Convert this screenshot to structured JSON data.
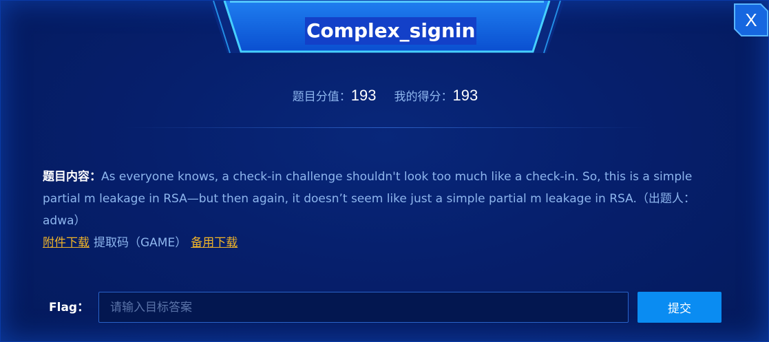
{
  "dialog": {
    "title": "Complex_signin",
    "close_label": "X"
  },
  "score": {
    "points_label": "题目分值：",
    "points_value": "193",
    "my_score_label": "我的得分：",
    "my_score_value": "193"
  },
  "content": {
    "label": "题目内容：",
    "text": "As everyone knows, a check-in challenge shouldn't look too much like a check-in. So, this is a simple partial m leakage in RSA—but then again, it doesn’t seem like just a simple partial m leakage in RSA.（出题人：adwa）",
    "download_link": "附件下载",
    "extract_code": "提取码（GAME）",
    "backup_link": "备用下载"
  },
  "flag": {
    "label": "Flag：",
    "placeholder": "请输入目标答案",
    "value": "",
    "submit_label": "提交"
  },
  "colors": {
    "background": "#061f6c",
    "accent": "#0a8cf2",
    "link": "#f0b429",
    "text_muted": "#8eb6ee"
  }
}
